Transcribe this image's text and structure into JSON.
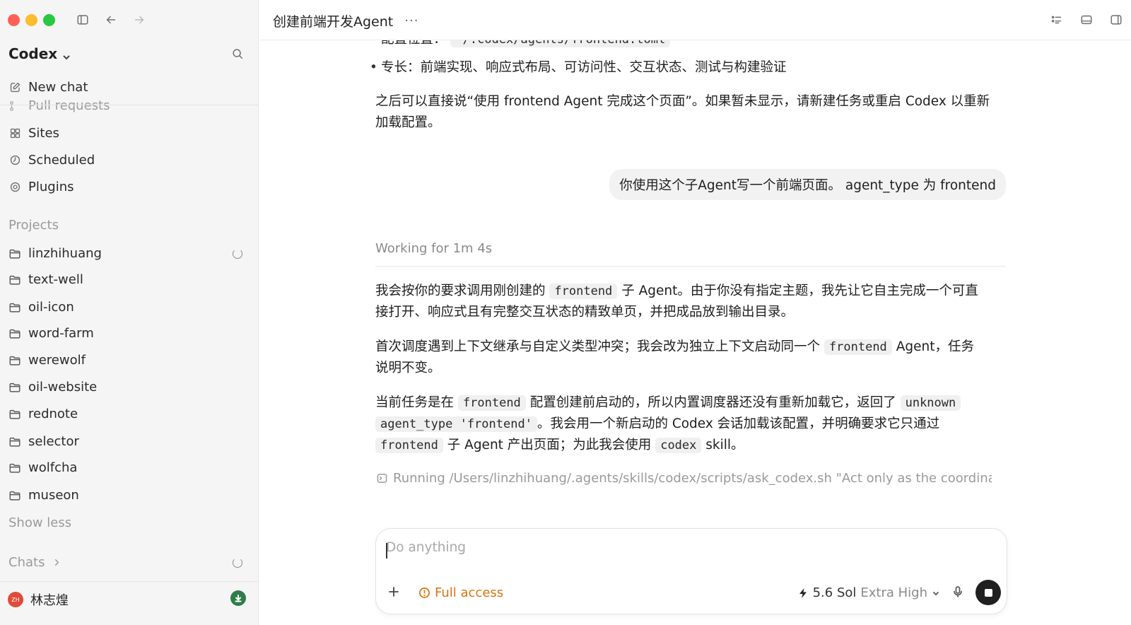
{
  "sidebar": {
    "app_name": "Codex",
    "new_chat_label": "New chat",
    "clipped_item_label": "Pull requests",
    "nav_items": [
      {
        "label": "Sites",
        "icon": "sites-icon"
      },
      {
        "label": "Scheduled",
        "icon": "clock-icon"
      },
      {
        "label": "Plugins",
        "icon": "plugins-icon"
      }
    ],
    "projects_label": "Projects",
    "projects": [
      "linzhihuang",
      "text-well",
      "oil-icon",
      "word-farm",
      "werewolf",
      "oil-website",
      "rednote",
      "selector",
      "wolfcha",
      "museon"
    ],
    "show_less_label": "Show less",
    "chats_label": "Chats",
    "user_name": "林志煌",
    "user_initials": "ZH"
  },
  "header": {
    "chat_title": "创建前端开发Agent",
    "more_label": "···"
  },
  "conversation": {
    "clipped_line_label": "配置位置：",
    "clipped_line_code": "~/.codex/agents/frontend.toml",
    "bullet_specialty": "专长：前端实现、响应式布局、可访问性、交互状态、测试与构建验证",
    "after_text": "之后可以直接说“使用 frontend Agent 完成这个页面”。如果暂未显示，请新建任务或重启 Codex 以重新加载配置。",
    "after_text_line1": "之后可以直接说“使用 frontend Agent 完成这个页面”。如果暂未显示，请新建任务或重启 Codex 以重新",
    "after_text_line2": "加载配置。",
    "user_message": "你使用这个子Agent写一个前端页面。 agent_type 为 frontend",
    "working_status": "Working for 1m 4s",
    "p1_a": "我会按你的要求调用刚创建的",
    "p1_code": "frontend",
    "p1_b": "子 Agent。由于你没有指定主题，我先让它自主完成一个可直",
    "p1_c": "接打开、响应式且有完整交互状态的精致单页，并把成品放到输出目录。",
    "p2_a": "首次调度遇到上下文继承与自定义类型冲突；我会改为独立上下文启动同一个",
    "p2_code": "frontend",
    "p2_b": "Agent，任务",
    "p2_c": "说明不变。",
    "p3_a": "当前任务是在",
    "p3_code1": "frontend",
    "p3_b": "配置创建前启动的，所以内置调度器还没有重新加载它，返回了",
    "p3_code2": "unknown",
    "p3_code3": "agent_type 'frontend'",
    "p3_c": "。我会用一个新启动的 Codex 会话加载该配置，并明确要求它只通过",
    "p3_code4": "frontend",
    "p3_d": "子 Agent 产出页面；为此我会使用",
    "p3_code5": "codex",
    "p3_e": "skill。",
    "running_command": "Running /Users/linzhihuang/.agents/skills/codex/scripts/ask_codex.sh \"Act only as the coordinat"
  },
  "composer": {
    "placeholder": "Do anything",
    "access_label": "Full access",
    "model_name": "5.6 Sol",
    "effort_label": "Extra High"
  },
  "colors": {
    "access_accent": "#d9730d",
    "traffic_close": "#ff5f57",
    "traffic_min": "#febc2e",
    "traffic_max": "#28c840"
  }
}
